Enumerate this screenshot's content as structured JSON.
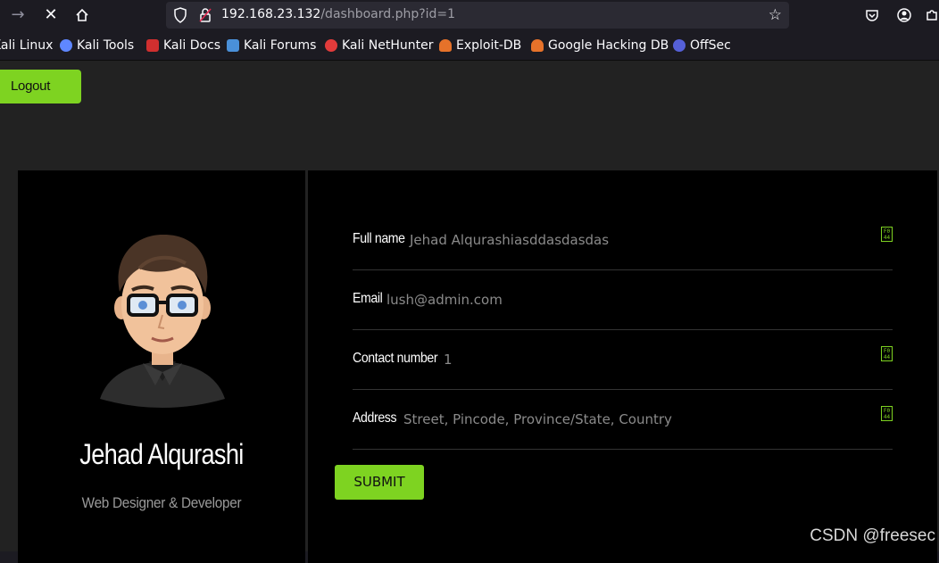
{
  "browser": {
    "url_host": "192.168.23.132",
    "url_path": "/dashboard.php?id=1"
  },
  "bookmarks": [
    {
      "label": "Kali Linux",
      "color": "#367bf0"
    },
    {
      "label": "Kali Tools",
      "color": "#5f87ff"
    },
    {
      "label": "Kali Docs",
      "color": "#d02f2f"
    },
    {
      "label": "Kali Forums",
      "color": "#4a90d9"
    },
    {
      "label": "Kali NetHunter",
      "color": "#e23b3b"
    },
    {
      "label": "Exploit-DB",
      "color": "#e6722a"
    },
    {
      "label": "Google Hacking DB",
      "color": "#e6722a"
    },
    {
      "label": "OffSec",
      "color": "#5560d8"
    }
  ],
  "page": {
    "logout_label": "Logout",
    "profile": {
      "name": "Jehad Alqurashi",
      "role": "Web Designer & Developer"
    },
    "fields": [
      {
        "label": "Full name",
        "value": "Jehad Alqurashiasddasdasdas",
        "badge": "F0\n44"
      },
      {
        "label": "Email",
        "value": "lush@admin.com",
        "badge": ""
      },
      {
        "label": "Contact number",
        "value": "1",
        "badge": "F0\n44"
      },
      {
        "label": "Address",
        "value": "Street, Pincode, Province/State, Country",
        "badge": "F0\n44"
      }
    ],
    "submit_label": "SUBMIT"
  },
  "watermark": "CSDN @freesec",
  "colors": {
    "accent": "#7ed321",
    "page_bg": "#222222",
    "card_bg": "#000000"
  }
}
